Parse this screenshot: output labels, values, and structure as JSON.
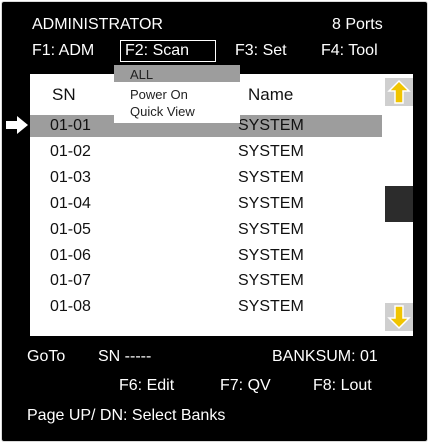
{
  "header": {
    "title": "ADMINISTRATOR",
    "ports": "8 Ports"
  },
  "menu": {
    "f1": "F1: ADM",
    "f2": "F2: Scan",
    "f3": "F3: Set",
    "f4": "F4: Tool"
  },
  "scan_dropdown": {
    "items": [
      "ALL",
      "Power On",
      "Quick View"
    ],
    "selected": "ALL"
  },
  "list": {
    "col_sn": "SN",
    "col_name": "Name",
    "selected_index": 0,
    "rows": [
      {
        "sn": "01-01",
        "name": "SYSTEM"
      },
      {
        "sn": "01-02",
        "name": "SYSTEM"
      },
      {
        "sn": "01-03",
        "name": "SYSTEM"
      },
      {
        "sn": "01-04",
        "name": "SYSTEM"
      },
      {
        "sn": "01-05",
        "name": "SYSTEM"
      },
      {
        "sn": "01-06",
        "name": "SYSTEM"
      },
      {
        "sn": "01-07",
        "name": "SYSTEM"
      },
      {
        "sn": "01-08",
        "name": "SYSTEM"
      }
    ]
  },
  "footer": {
    "goto": "GoTo",
    "sn": "SN -----",
    "banksum": "BANKSUM: 01",
    "f6": "F6: Edit",
    "f7": "F7: QV",
    "f8": "F8: Lout",
    "page_hint": "Page UP/ DN:  Select Banks"
  },
  "icons": {
    "scroll_up": "up-arrow-icon",
    "scroll_down": "down-arrow-icon",
    "row_pointer": "right-arrow-icon"
  },
  "colors": {
    "screen_bg": "#000000",
    "panel_bg": "#ffffff",
    "selection": "#9d9d9d",
    "arrow_fill": "#f0c400"
  }
}
